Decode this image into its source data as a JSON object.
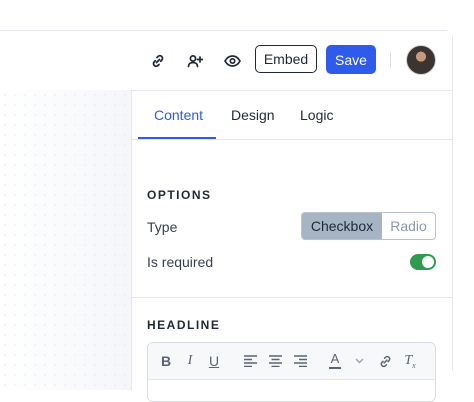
{
  "header": {
    "link_icon": "link-icon",
    "add_user_icon": "add-user-icon",
    "preview_icon": "eye-icon",
    "embed_label": "Embed",
    "save_label": "Save",
    "avatar": "user-avatar"
  },
  "panel": {
    "tabs": [
      {
        "label": "Content",
        "active": true
      },
      {
        "label": "Design",
        "active": false
      },
      {
        "label": "Logic",
        "active": false
      }
    ],
    "options": {
      "title": "OPTIONS",
      "type_label": "Type",
      "type_options": [
        "Checkbox",
        "Radio"
      ],
      "type_selected": "Checkbox",
      "required_label": "Is required",
      "required_on": true
    },
    "headline": {
      "title": "HEADLINE",
      "toolbar": [
        "bold-icon",
        "italic-icon",
        "underline-icon",
        "align-left-icon",
        "align-center-icon",
        "align-right-icon",
        "text-color-icon",
        "chevron-down-icon",
        "link-icon",
        "clear-format-icon"
      ]
    }
  },
  "colors": {
    "accent": "#2f5bea",
    "toggle_on": "#2e9b4e",
    "segment_selected": "#a6b4c3"
  }
}
